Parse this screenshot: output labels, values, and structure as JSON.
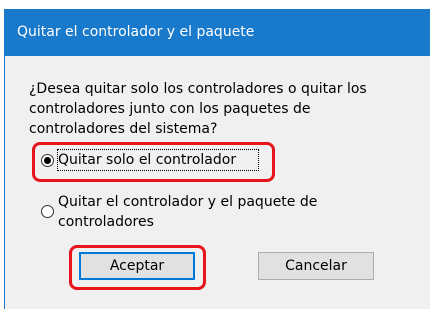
{
  "window": {
    "title": "Quitar el controlador y el paquete"
  },
  "message": "¿Desea quitar solo los controladores o quitar los controladores junto con los paquetes de controladores del sistema?",
  "options": [
    {
      "label": "Quitar solo el controlador",
      "selected": true
    },
    {
      "label": "Quitar el controlador y el paquete de controladores",
      "selected": false
    }
  ],
  "buttons": {
    "ok_label": "Aceptar",
    "cancel_label": "Cancelar"
  },
  "colors": {
    "titlebar": "#1979ca",
    "highlight": "#e8141c"
  }
}
